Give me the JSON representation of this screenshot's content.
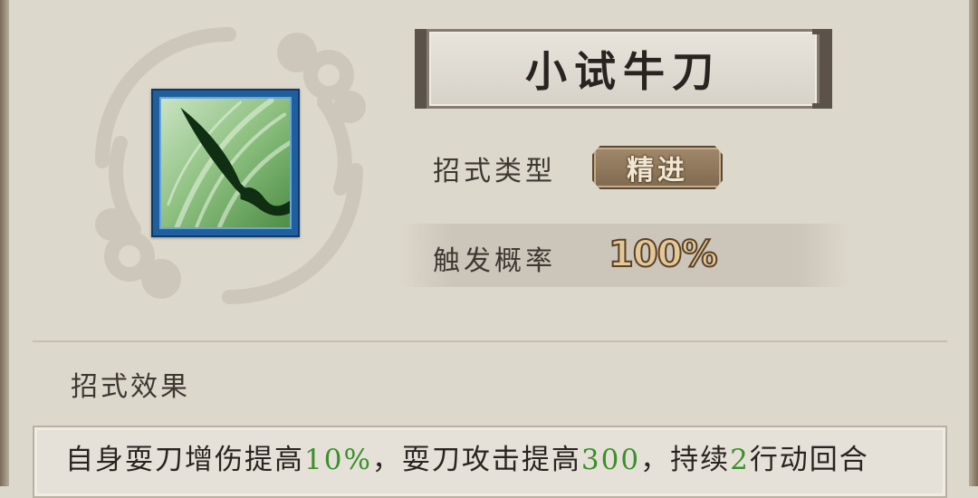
{
  "skill": {
    "name": "小试牛刀",
    "icon": "curved-blade-icon",
    "type_label": "招式类型",
    "type_value": "精进",
    "rate_label": "触发概率",
    "rate_value": "100%"
  },
  "effect": {
    "heading": "招式效果",
    "segments": [
      "自身耍刀增伤提高",
      "10%",
      "，耍刀攻击提高",
      "300",
      "，持续",
      "2",
      "行动回合"
    ]
  },
  "colors": {
    "background": "#ddd8cc",
    "highlight": "#3c8f2c",
    "icon_frame": "#1f5f9e",
    "badge": "#8f785c"
  }
}
